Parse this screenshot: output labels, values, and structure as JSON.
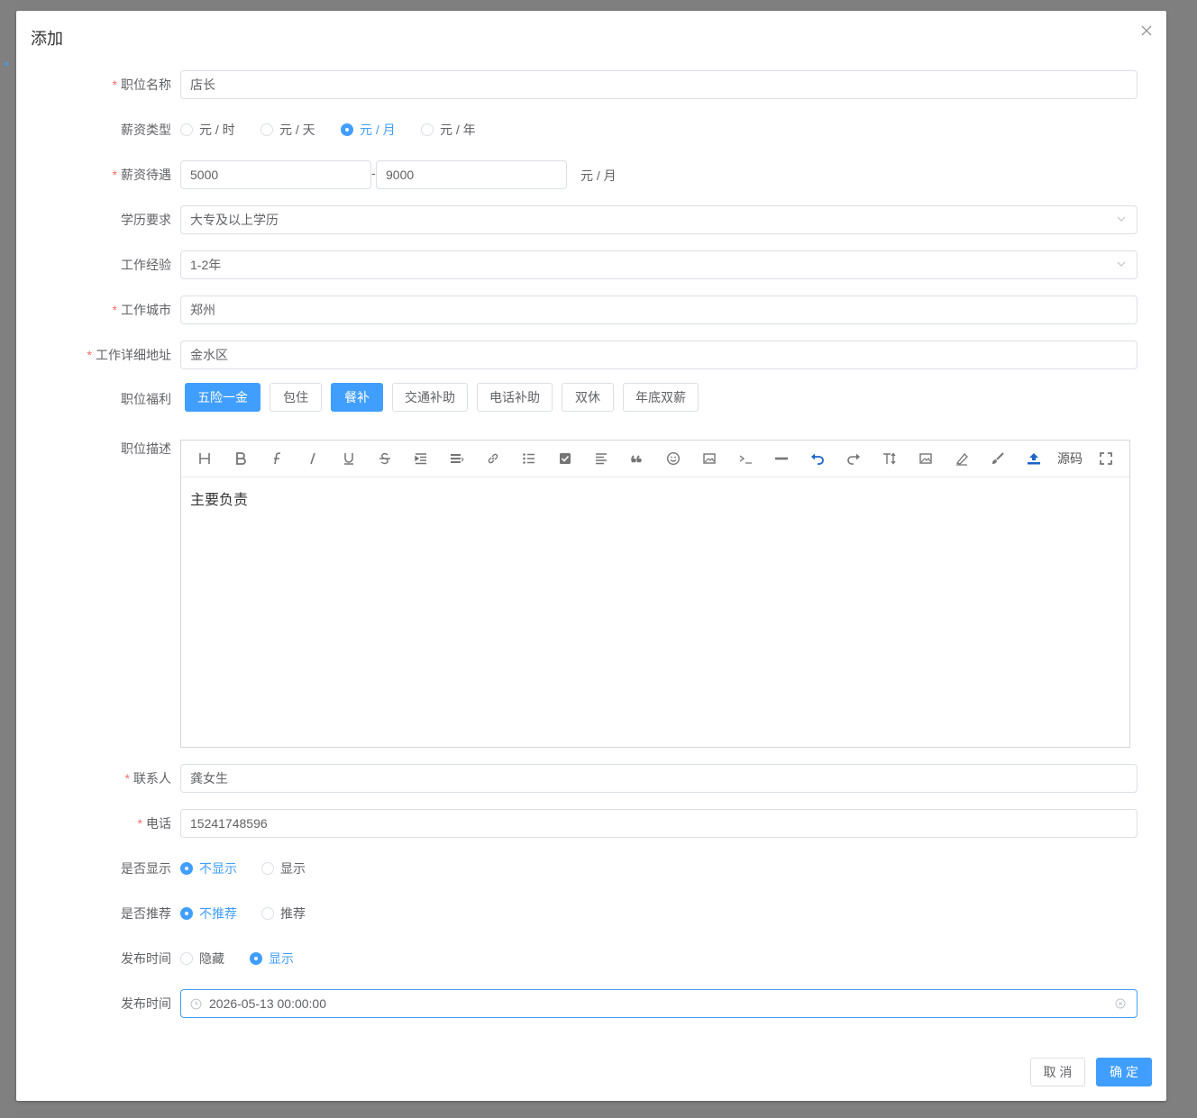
{
  "dialog": {
    "title": "添加",
    "cancel_label": "取 消",
    "confirm_label": "确 定"
  },
  "background": {
    "tab_close_glyph": "×"
  },
  "form": {
    "job_name": {
      "label": "职位名称",
      "value": "店长",
      "required": true
    },
    "salary_type": {
      "label": "薪资类型",
      "options": [
        "元 / 时",
        "元 / 天",
        "元 / 月",
        "元 / 年"
      ],
      "selected": "元 / 月"
    },
    "salary": {
      "label": "薪资待遇",
      "min": "5000",
      "separator": "-",
      "max": "9000",
      "unit": "元 / 月",
      "required": true
    },
    "education": {
      "label": "学历要求",
      "value": "大专及以上学历"
    },
    "experience": {
      "label": "工作经验",
      "value": "1-2年"
    },
    "city": {
      "label": "工作城市",
      "value": "郑州",
      "required": true
    },
    "address": {
      "label": "工作详细地址",
      "value": "金水区",
      "required": true
    },
    "benefits": {
      "label": "职位福利",
      "tags": [
        {
          "text": "五险一金",
          "selected": true
        },
        {
          "text": "包住",
          "selected": false
        },
        {
          "text": "餐补",
          "selected": true
        },
        {
          "text": "交通补助",
          "selected": false
        },
        {
          "text": "电话补助",
          "selected": false
        },
        {
          "text": "双休",
          "selected": false
        },
        {
          "text": "年底双薪",
          "selected": false
        }
      ]
    },
    "description": {
      "label": "职位描述",
      "content": "主要负责",
      "toolbar_source_label": "源码",
      "toolbar_icons": [
        "header-icon",
        "bold-icon",
        "font-icon",
        "italic-icon",
        "underline-icon",
        "strikethrough-icon",
        "indent-icon",
        "align-icon",
        "link-icon",
        "unordered-list-icon",
        "checklist-icon",
        "paragraph-icon",
        "quote-icon",
        "emoji-icon",
        "image-icon",
        "code-icon",
        "horizontal-rule-icon",
        "undo-icon",
        "redo-icon",
        "font-size-icon",
        "image-upload-icon",
        "eraser-icon",
        "brush-icon",
        "upload-icon",
        "fullscreen-icon"
      ]
    },
    "contact": {
      "label": "联系人",
      "value": "龚女生",
      "required": true
    },
    "phone": {
      "label": "电话",
      "value": "15241748596",
      "required": true
    },
    "show": {
      "label": "是否显示",
      "options": [
        "不显示",
        "显示"
      ],
      "selected": "不显示"
    },
    "recommend": {
      "label": "是否推荐",
      "options": [
        "不推荐",
        "推荐"
      ],
      "selected": "不推荐"
    },
    "publish_visibility": {
      "label": "发布时间",
      "options": [
        "隐藏",
        "显示"
      ],
      "selected": "显示"
    },
    "publish_time": {
      "label": "发布时间",
      "value": "2026-05-13 00:00:00"
    }
  },
  "colors": {
    "primary": "#409eff",
    "required": "#f56c6c",
    "text": "#606266",
    "border": "#dcdfe6"
  }
}
